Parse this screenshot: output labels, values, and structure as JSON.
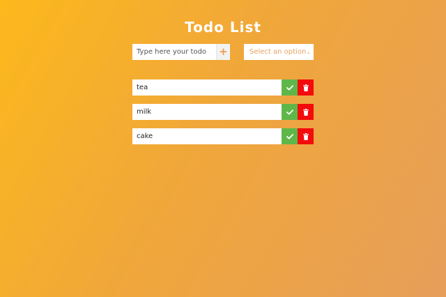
{
  "header": {
    "title": "Todo List"
  },
  "form": {
    "input_placeholder": "Type here your todo",
    "input_value": "",
    "add_icon": "plus-icon",
    "filter_selected": "Select an option"
  },
  "todos": [
    {
      "text": "tea",
      "complete_icon": "check-icon",
      "delete_icon": "trash-icon"
    },
    {
      "text": "milk",
      "complete_icon": "check-icon",
      "delete_icon": "trash-icon"
    },
    {
      "text": "cake",
      "complete_icon": "check-icon",
      "delete_icon": "trash-icon"
    }
  ],
  "colors": {
    "complete": "#5fb749",
    "delete": "#f40b0b",
    "accent": "#ec9a55"
  }
}
